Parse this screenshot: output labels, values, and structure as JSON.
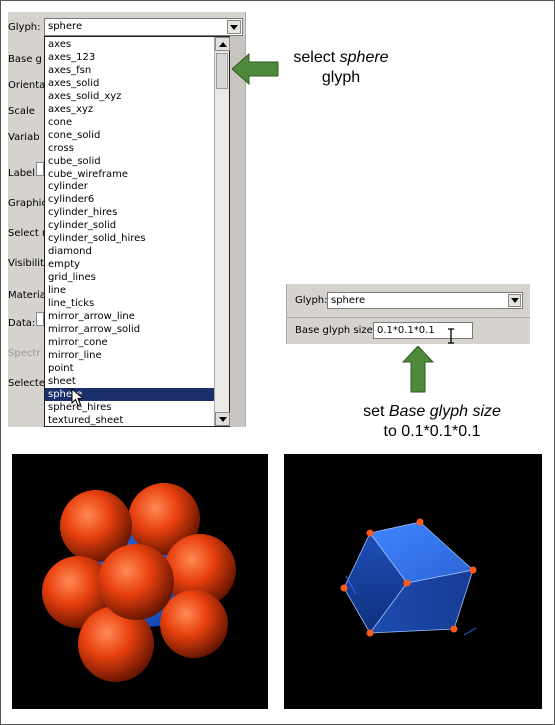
{
  "left_panel": {
    "glyph_label": "Glyph:",
    "glyph_value": "sphere",
    "side_labels": [
      "Base g",
      "Orienta",
      "Scale",
      "Variab",
      "Label:",
      "Graphic",
      "Select m",
      "Visibility",
      "Materia",
      "Data:",
      "Spectr",
      "Selected"
    ],
    "dropdown_items": [
      "axes",
      "axes_123",
      "axes_fsn",
      "axes_solid",
      "axes_solid_xyz",
      "axes_xyz",
      "cone",
      "cone_solid",
      "cross",
      "cube_solid",
      "cube_wireframe",
      "cylinder",
      "cylinder6",
      "cylinder_hires",
      "cylinder_solid",
      "cylinder_solid_hires",
      "diamond",
      "empty",
      "grid_lines",
      "line",
      "line_ticks",
      "mirror_arrow_line",
      "mirror_arrow_solid",
      "mirror_cone",
      "mirror_line",
      "point",
      "sheet",
      "sphere",
      "sphere_hires",
      "textured_sheet"
    ],
    "selected_item": "sphere"
  },
  "callout_top": {
    "line1_a": "select ",
    "line1_b": "sphere",
    "line2": "glyph"
  },
  "right_panel": {
    "glyph_label": "Glyph:",
    "glyph_value": "sphere",
    "size_label": "Base glyph size:",
    "size_value": "0.1*0.1*0.1"
  },
  "callout_bottom": {
    "line1_a": "set ",
    "line1_b": "Base glyph size",
    "line2": "to 0.1*0.1*0.1"
  },
  "colors": {
    "arrow": "#4f8a3c",
    "sphere": "#e8400e",
    "cube": "#2f6fe0",
    "selection": "#1a2f6b"
  }
}
